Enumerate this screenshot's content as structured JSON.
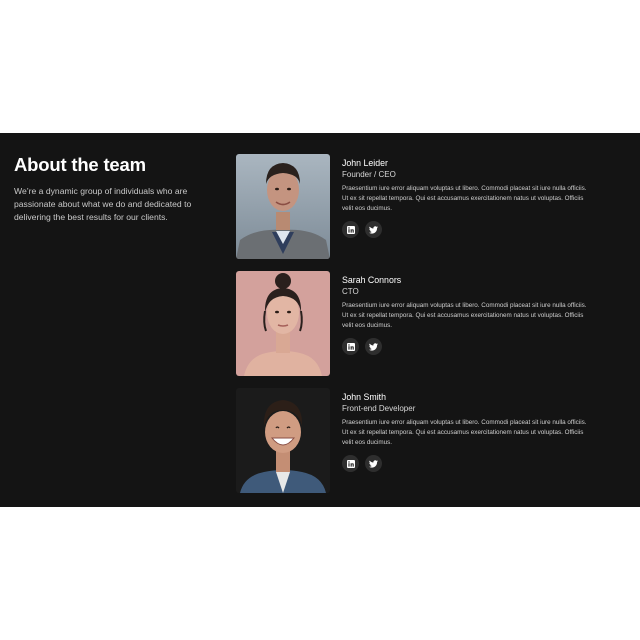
{
  "intro": {
    "title": "About the team",
    "description": "We’re a dynamic group of individuals who are passionate about what we do and dedicated to delivering the best results for our clients."
  },
  "members": [
    {
      "name": "John Leider",
      "role": "Founder / CEO",
      "bio": "Praesentium iure error aliquam voluptas ut libero. Commodi placeat sit iure nulla officiis. Ut ex sit repellat tempora. Qui est accusamus exercitationem natus ut voluptas. Officiis velit eos ducimus.",
      "socials": [
        "linkedin-icon",
        "twitter-icon"
      ]
    },
    {
      "name": "Sarah Connors",
      "role": "CTO",
      "bio": "Praesentium iure error aliquam voluptas ut libero. Commodi placeat sit iure nulla officiis. Ut ex sit repellat tempora. Qui est accusamus exercitationem natus ut voluptas. Officiis velit eos ducimus.",
      "socials": [
        "linkedin-icon",
        "twitter-icon"
      ]
    },
    {
      "name": "John Smith",
      "role": "Front-end Developer",
      "bio": "Praesentium iure error aliquam voluptas ut libero. Commodi placeat sit iure nulla officiis. Ut ex sit repellat tempora. Qui est accusamus exercitationem natus ut voluptas. Officiis velit eos ducimus.",
      "socials": [
        "linkedin-icon",
        "twitter-icon"
      ]
    }
  ],
  "colors": {
    "section_background": "#141414",
    "page_background": "#ffffff",
    "social_button": "#2e2e2e"
  }
}
